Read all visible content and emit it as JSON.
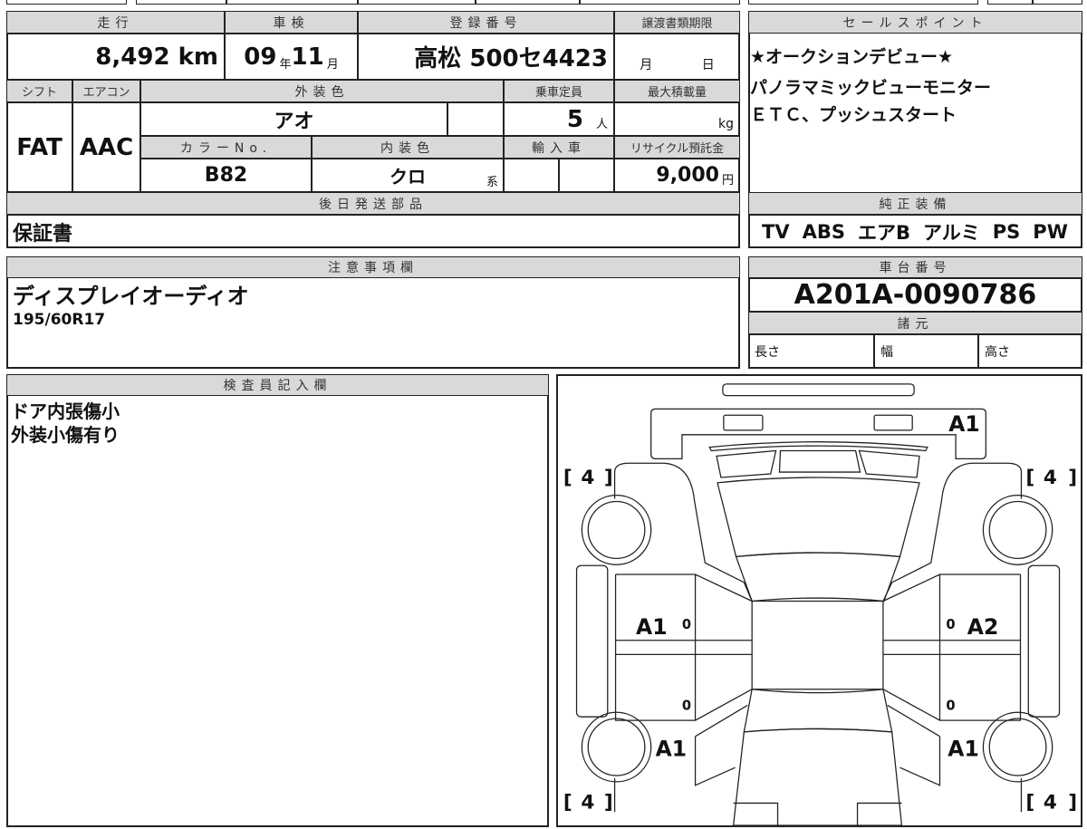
{
  "vehicle": {
    "mileage": {
      "label": "走行",
      "value": "8,492",
      "unit": "km"
    },
    "inspection": {
      "label": "車検",
      "year": "09",
      "year_unit": "年",
      "month": "11",
      "month_unit": "月"
    },
    "registration": {
      "label": "登録番号",
      "value": "高松 500セ4423"
    },
    "transfer_deadline": {
      "label": "譲渡書類期限",
      "month_unit": "月",
      "day_unit": "日"
    },
    "shift": {
      "label": "シフト",
      "value": "FAT"
    },
    "aircon": {
      "label": "エアコン",
      "value": "AAC"
    },
    "exterior_color": {
      "label": "外装色",
      "value": "アオ"
    },
    "capacity": {
      "label": "乗車定員",
      "value": "5",
      "unit": "人"
    },
    "max_load": {
      "label": "最大積載量",
      "unit": "kg"
    },
    "color_no": {
      "label": "カラーNo.",
      "value": "B82"
    },
    "interior_color": {
      "label": "内装色",
      "value": "クロ",
      "suffix": "系"
    },
    "import": {
      "label": "輸入車"
    },
    "recycle_fee": {
      "label": "リサイクル預託金",
      "value": "9,000",
      "unit": "円"
    },
    "later_parts": {
      "label": "後日発送部品",
      "value": "保証書"
    }
  },
  "notes": {
    "label": "注意事項欄",
    "lines": [
      "ディスプレイオーディオ",
      "195/60R17"
    ]
  },
  "inspector": {
    "label": "検査員記入欄",
    "lines": [
      "ドア内張傷小",
      "外装小傷有り"
    ]
  },
  "sales_points": {
    "label": "セールスポイント",
    "lines": [
      "★オークションデビュー★",
      "パノラマミックビューモニター",
      "ＥＴＣ、プッシュスタート"
    ]
  },
  "equipment": {
    "label": "純正装備",
    "items": [
      "TV",
      "ABS",
      "エアB",
      "アルミ",
      "PS",
      "PW"
    ]
  },
  "chassis": {
    "label": "車台番号",
    "value": "A201A-0090786"
  },
  "specs": {
    "label": "諸元",
    "length": "長さ",
    "width": "幅",
    "height": "高さ"
  },
  "diagram": {
    "marks": {
      "front_bumper": "A1",
      "left_front_door": "A1",
      "right_front_door": "A2",
      "left_rear": "A1",
      "right_rear": "A1"
    },
    "tire_tread": {
      "front_left": "4",
      "front_right": "4",
      "rear_left": "4",
      "rear_right": "4"
    },
    "door_zero": "0"
  }
}
